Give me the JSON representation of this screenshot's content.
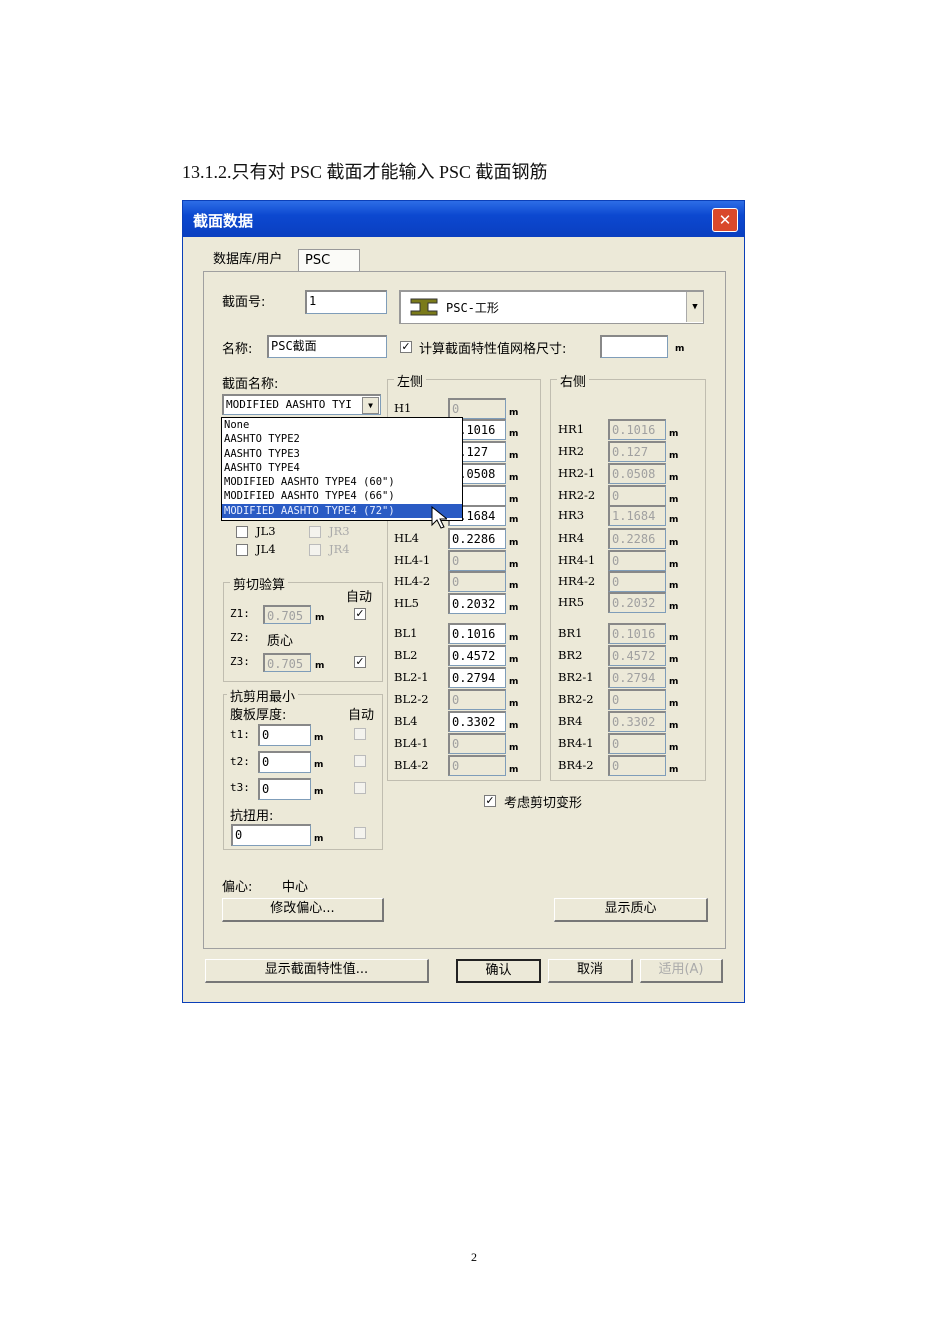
{
  "heading": "13.1.2.只有对 PSC 截面才能输入 PSC 截面钢筋",
  "page_number": "2",
  "dialog": {
    "title": "截面数据",
    "tabs": [
      "数据库/用户",
      "PSC"
    ],
    "section_no_label": "截面号:",
    "section_no": "1",
    "shape_type": "PSC-工形",
    "name_label": "名称:",
    "name": "PSC截面",
    "mesh_checkbox_label": "计算截面特性值网格尺寸:",
    "mesh_checked": true,
    "mesh_size": "",
    "unit": "m",
    "section_name_label": "截面名称:",
    "section_name_selected": "MODIFIED AASHTO TYI",
    "section_name_options": [
      "None",
      "AASHTO TYPE2",
      "AASHTO TYPE3",
      "AASHTO TYPE4",
      "MODIFIED AASHTO TYPE4 (60\")",
      "MODIFIED AASHTO TYPE4 (66\")",
      "MODIFIED AASHTO TYPE4 (72\")"
    ],
    "joints": [
      {
        "label": "JL3",
        "enabled": true
      },
      {
        "label": "JR3",
        "enabled": false
      },
      {
        "label": "JL4",
        "enabled": true
      },
      {
        "label": "JR4",
        "enabled": false
      }
    ],
    "shear_check": {
      "title": "剪切验算",
      "auto_label": "自动",
      "z1_label": "Z1:",
      "z1": "0.705",
      "z2_label": "Z2:",
      "z2": "质心",
      "z3_label": "Z3:",
      "z3": "0.705"
    },
    "min_web": {
      "title": "抗剪用最小",
      "subtitle": "腹板厚度:",
      "auto_label": "自动",
      "t1_label": "t1:",
      "t1": "0",
      "t2_label": "t2:",
      "t2": "0",
      "t3_label": "t3:",
      "t3": "0",
      "torsion_label": "抗扭用:",
      "torsion": "0"
    },
    "left_side": {
      "title": "左侧",
      "rows": [
        {
          "label": "H1",
          "value": "0",
          "enabled": false
        },
        {
          "label": "",
          "value": "0.1016",
          "enabled": true
        },
        {
          "label": "",
          "value": "0.127",
          "enabled": true
        },
        {
          "label": "",
          "value": "0.0508",
          "enabled": true
        },
        {
          "label": "",
          "value": "",
          "enabled": true
        },
        {
          "label": "",
          "value": "1.1684",
          "enabled": true
        },
        {
          "label": "HL4",
          "value": "0.2286",
          "enabled": true
        },
        {
          "label": "HL4-1",
          "value": "0",
          "enabled": false
        },
        {
          "label": "HL4-2",
          "value": "0",
          "enabled": false
        },
        {
          "label": "HL5",
          "value": "0.2032",
          "enabled": true
        },
        {
          "label": "BL1",
          "value": "0.1016",
          "enabled": true
        },
        {
          "label": "BL2",
          "value": "0.4572",
          "enabled": true
        },
        {
          "label": "BL2-1",
          "value": "0.2794",
          "enabled": true
        },
        {
          "label": "BL2-2",
          "value": "0",
          "enabled": false
        },
        {
          "label": "BL4",
          "value": "0.3302",
          "enabled": true
        },
        {
          "label": "BL4-1",
          "value": "0",
          "enabled": false
        },
        {
          "label": "BL4-2",
          "value": "0",
          "enabled": false
        }
      ]
    },
    "right_side": {
      "title": "右侧",
      "rows": [
        {
          "label": "HR1",
          "value": "0.1016"
        },
        {
          "label": "HR2",
          "value": "0.127"
        },
        {
          "label": "HR2-1",
          "value": "0.0508"
        },
        {
          "label": "HR2-2",
          "value": "0"
        },
        {
          "label": "HR3",
          "value": "1.1684"
        },
        {
          "label": "HR4",
          "value": "0.2286"
        },
        {
          "label": "HR4-1",
          "value": "0"
        },
        {
          "label": "HR4-2",
          "value": "0"
        },
        {
          "label": "HR5",
          "value": "0.2032"
        },
        {
          "label": "BR1",
          "value": "0.1016"
        },
        {
          "label": "BR2",
          "value": "0.4572"
        },
        {
          "label": "BR2-1",
          "value": "0.2794"
        },
        {
          "label": "BR2-2",
          "value": "0"
        },
        {
          "label": "BR4",
          "value": "0.3302"
        },
        {
          "label": "BR4-1",
          "value": "0"
        },
        {
          "label": "BR4-2",
          "value": "0"
        }
      ]
    },
    "shear_deform_label": "考虑剪切变形",
    "eccentric_label": "偏心:",
    "eccentric_value": "中心",
    "modify_eccentric_button": "修改偏心...",
    "show_centroid_button": "显示质心",
    "show_props_button": "显示截面特性值...",
    "ok_button": "确认",
    "cancel_button": "取消",
    "apply_button": "适用(A)"
  }
}
